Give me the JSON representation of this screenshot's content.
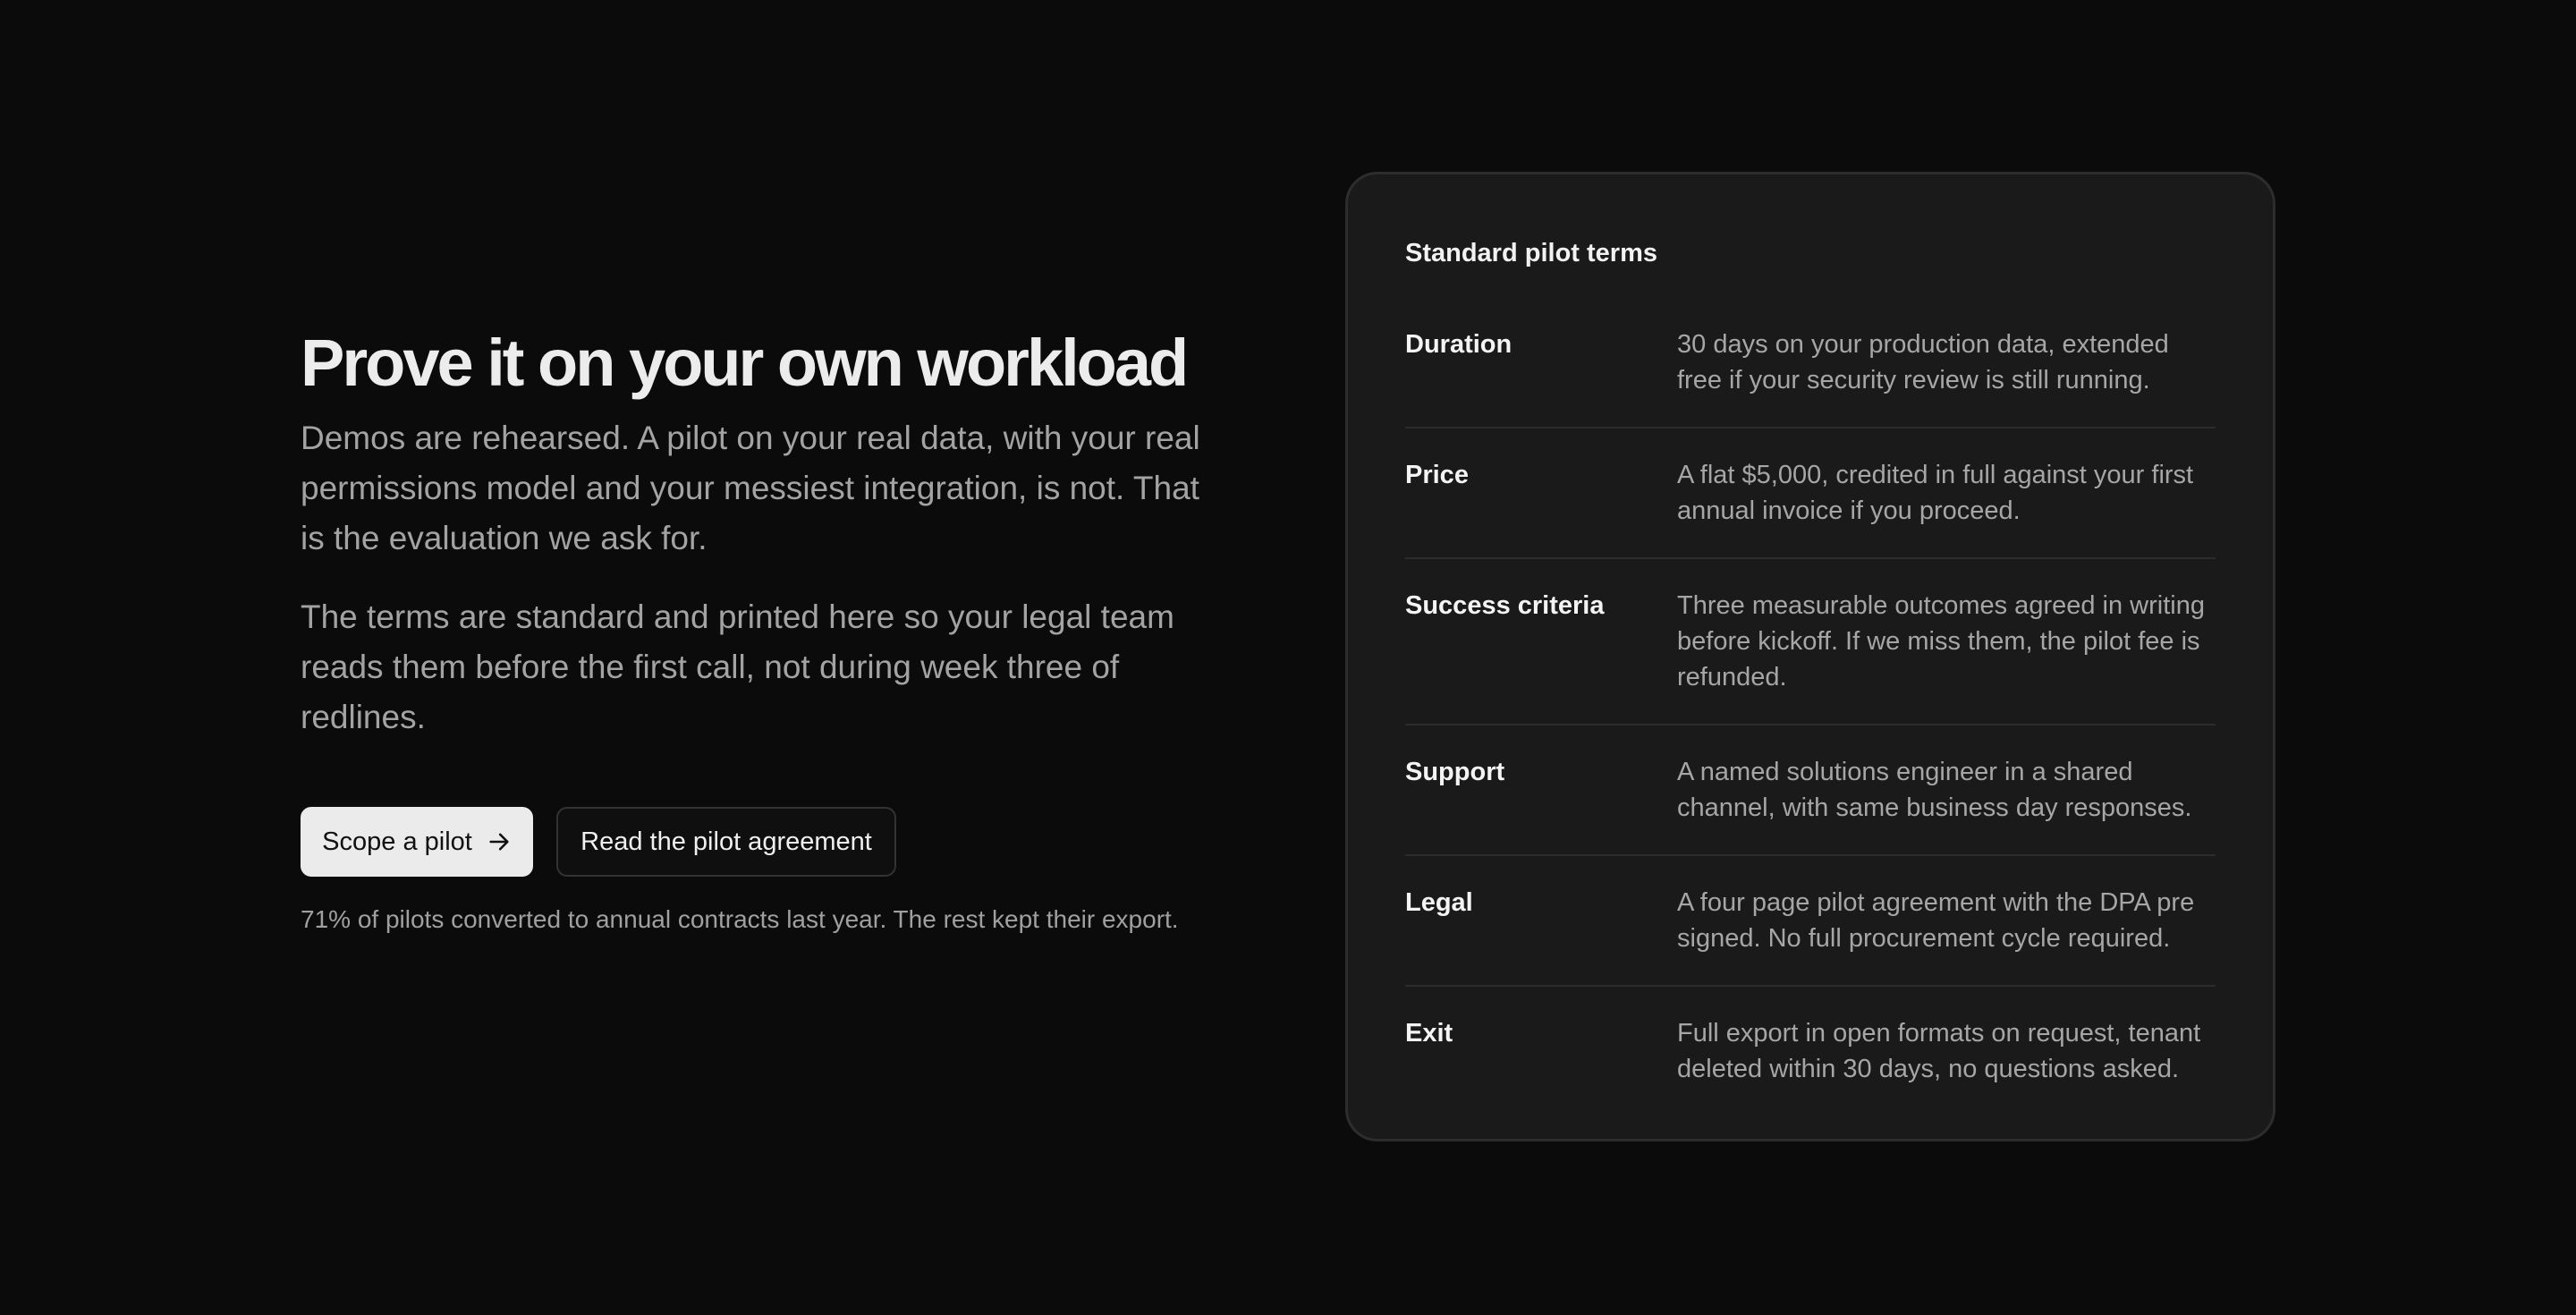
{
  "hero": {
    "headline": "Prove it on your own workload",
    "paragraph1": "Demos are rehearsed. A pilot on your real data, with your real permissions model and your messiest integration, is not. That is the evaluation we ask for.",
    "paragraph2": "The terms are standard and printed here so your legal team reads them before the first call, not during week three of redlines.",
    "primary_button": "Scope a pilot",
    "secondary_button": "Read the pilot agreement",
    "footnote": "71% of pilots converted to annual contracts last year. The rest kept their export."
  },
  "terms_card": {
    "title": "Standard pilot terms",
    "rows": [
      {
        "label": "Duration",
        "value": "30 days on your production data, extended free if your security review is still running."
      },
      {
        "label": "Price",
        "value": "A flat $5,000, credited in full against your first annual invoice if you proceed."
      },
      {
        "label": "Success criteria",
        "value": "Three measurable outcomes agreed in writing before kickoff. If we miss them, the pilot fee is refunded."
      },
      {
        "label": "Support",
        "value": "A named solutions engineer in a shared channel, with same business day responses."
      },
      {
        "label": "Legal",
        "value": "A four page pilot agreement with the DPA pre signed. No full procurement cycle required."
      },
      {
        "label": "Exit",
        "value": "Full export in open formats on request, tenant deleted within 30 days, no questions asked."
      }
    ]
  }
}
